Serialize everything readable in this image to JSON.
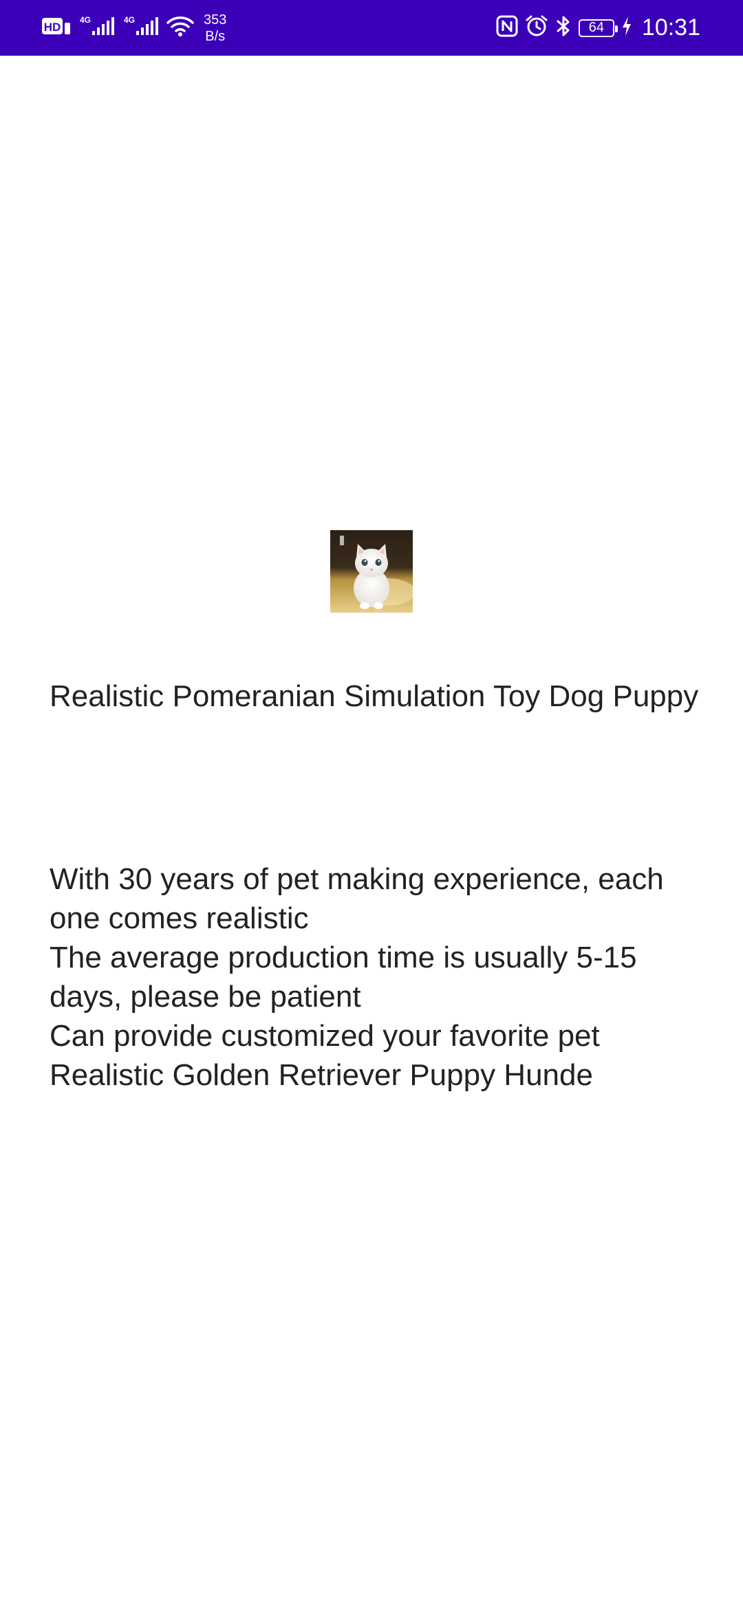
{
  "status_bar": {
    "net_speed_value": "353",
    "net_speed_unit": "B/s",
    "battery_level": "64",
    "time": "10:31",
    "background_color": "#3b00b8",
    "icons_left": [
      "hd-icon",
      "signal-4g-icon",
      "signal-4g-icon",
      "wifi-icon"
    ],
    "icons_right": [
      "nfc-icon",
      "alarm-icon",
      "bluetooth-icon",
      "battery-icon",
      "charging-icon"
    ]
  },
  "product": {
    "image_icon": "white-kitten-photo",
    "title": "Realistic Pomeranian Simulation Toy Dog Puppy",
    "description": [
      "With 30 years of pet making experience, each one comes realistic",
      "The average production time is usually 5-15 days, please be patient",
      "Can provide customized your favorite pet",
      "Realistic Golden Retriever Puppy Hunde"
    ]
  }
}
